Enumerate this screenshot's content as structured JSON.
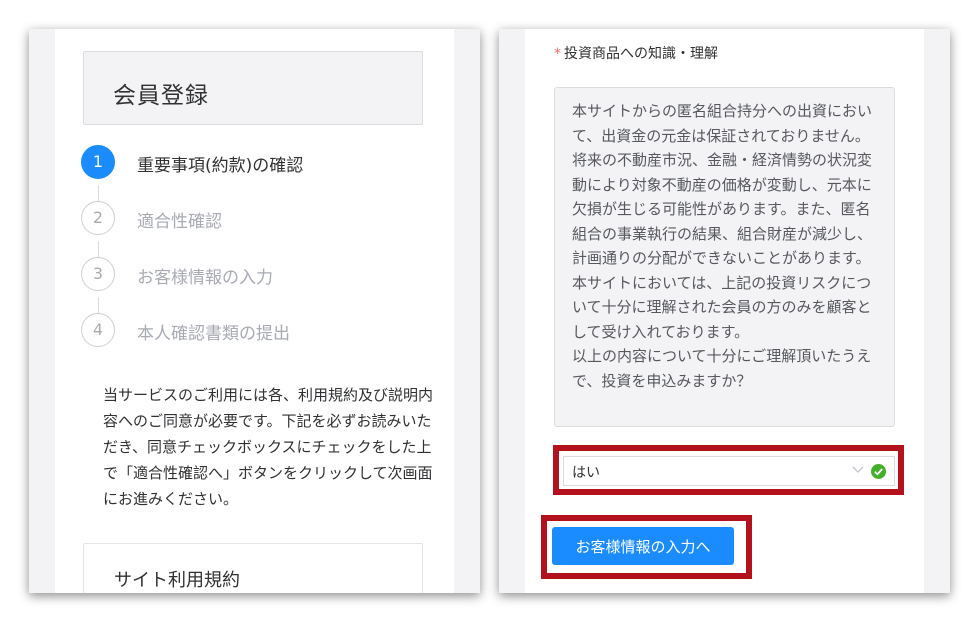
{
  "left": {
    "header_title": "会員登録",
    "steps": [
      {
        "number": "1",
        "label": "重要事項(約款)の確認",
        "active": true
      },
      {
        "number": "2",
        "label": "適合性確認",
        "active": false
      },
      {
        "number": "3",
        "label": "お客様情報の入力",
        "active": false
      },
      {
        "number": "4",
        "label": "本人確認書類の提出",
        "active": false
      }
    ],
    "intro_text": "当サービスのご利用には各、利用規約及び説明内容へのご同意が必要です。下記を必ずお読みいただき、同意チェックボックスにチェックをした上で「適合性確認へ」ボタンをクリックして次画面にお進みください。",
    "terms_title": "サイト利用規約"
  },
  "right": {
    "required_mark": "*",
    "question_label": "投資商品への知識・理解",
    "question_text": "本サイトからの匿名組合持分への出資において、出資金の元金は保証されておりません。将来の不動産市況、金融・経済情勢の状況変動により対象不動産の価格が変動し、元本に欠損が生じる可能性があります。また、匿名組合の事業執行の結果、組合財産が減少し、計画通りの分配ができないことがあります。\n本サイトにおいては、上記の投資リスクについて十分に理解された会員の方のみを顧客として受け入れております。\n以上の内容について十分にご理解頂いたうえで、投資を申込みますか？",
    "select_value": "はい",
    "submit_button": "お客様情報の入力へ"
  },
  "colors": {
    "primary": "#1a8cff",
    "highlight_red": "#b3121c",
    "success_green": "#43b02a",
    "required_red": "#f56c6c"
  },
  "icons": {
    "select_chevron": "chevron-down-icon",
    "select_valid": "check-circle-icon"
  }
}
